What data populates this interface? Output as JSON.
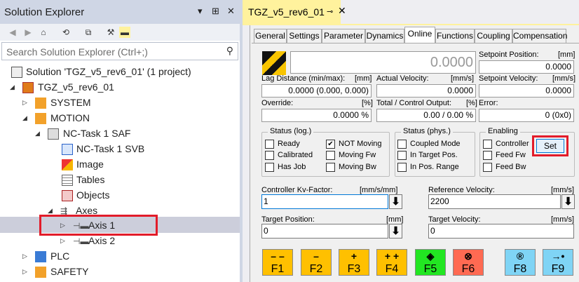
{
  "solution_explorer": {
    "title": "Solution Explorer",
    "title_controls": [
      "▾",
      "⊞",
      "✕"
    ],
    "search_placeholder": "Search Solution Explorer (Ctrl+;)",
    "tree": [
      {
        "label": "Solution 'TGZ_v5_rev6_01' (1 project)",
        "icon": "solution-icon"
      },
      {
        "label": "TGZ_v5_rev6_01",
        "icon": "project-icon"
      },
      {
        "label": "SYSTEM",
        "icon": "system-icon"
      },
      {
        "label": "MOTION",
        "icon": "motion-icon"
      },
      {
        "label": "NC-Task 1 SAF",
        "icon": "nc-task-icon"
      },
      {
        "label": "NC-Task 1 SVB",
        "icon": "nc-svb-icon"
      },
      {
        "label": "Image",
        "icon": "image-icon"
      },
      {
        "label": "Tables",
        "icon": "tables-icon"
      },
      {
        "label": "Objects",
        "icon": "objects-icon"
      },
      {
        "label": "Axes",
        "icon": "axes-icon"
      },
      {
        "label": "Axis 1",
        "icon": "axis-icon"
      },
      {
        "label": "Axis 2",
        "icon": "axis-icon"
      },
      {
        "label": "PLC",
        "icon": "plc-icon"
      },
      {
        "label": "SAFETY",
        "icon": "safety-icon"
      }
    ]
  },
  "document": {
    "tab_title": "TGZ_v5_rev6_01",
    "pin": "⊸",
    "close": "✕",
    "tabs": [
      "General",
      "Settings",
      "Parameter",
      "Dynamics",
      "Online",
      "Functions",
      "Coupling",
      "Compensation"
    ],
    "active_tab": "Online",
    "online": {
      "main_value": "0.0000",
      "setpoint_position": {
        "label": "Setpoint Position:",
        "unit": "[mm]",
        "value": "0.0000"
      },
      "lag_distance": {
        "label": "Lag Distance (min/max):",
        "unit": "[mm]",
        "value": "0.0000  (0.000, 0.000)"
      },
      "actual_velocity": {
        "label": "Actual Velocity:",
        "unit": "[mm/s]",
        "value": "0.0000"
      },
      "setpoint_velocity": {
        "label": "Setpoint Velocity:",
        "unit": "[mm/s]",
        "value": "0.0000"
      },
      "override": {
        "label": "Override:",
        "unit": "[%]",
        "value": "0.0000 %"
      },
      "total_control_output": {
        "label": "Total / Control Output:",
        "unit": "[%]",
        "value": "0.00 /  0.00 %"
      },
      "error": {
        "label": "Error:",
        "value": "0 (0x0)"
      },
      "status_log": {
        "title": "Status (log.)",
        "items": [
          {
            "label": "Ready",
            "checked": false
          },
          {
            "label": "NOT Moving",
            "checked": true
          },
          {
            "label": "Calibrated",
            "checked": false
          },
          {
            "label": "Moving Fw",
            "checked": false
          },
          {
            "label": "Has Job",
            "checked": false
          },
          {
            "label": "Moving Bw",
            "checked": false
          }
        ]
      },
      "status_phys": {
        "title": "Status (phys.)",
        "items": [
          {
            "label": "Coupled Mode",
            "checked": false
          },
          {
            "label": "In Target Pos.",
            "checked": false
          },
          {
            "label": "In Pos. Range",
            "checked": false
          }
        ]
      },
      "enabling": {
        "title": "Enabling",
        "items": [
          {
            "label": "Controller",
            "checked": false
          },
          {
            "label": "Feed Fw",
            "checked": false
          },
          {
            "label": "Feed Bw",
            "checked": false
          }
        ],
        "set_label": "Set"
      },
      "kv_factor": {
        "label": "Controller Kv-Factor:",
        "unit": "[mm/s/mm]",
        "value": "1"
      },
      "reference_velocity": {
        "label": "Reference Velocity:",
        "unit": "[mm/s]",
        "value": "2200"
      },
      "target_position": {
        "label": "Target Position:",
        "unit": "[mm]",
        "value": "0"
      },
      "target_velocity": {
        "label": "Target Velocity:",
        "unit": "[mm/s]",
        "value": "0"
      },
      "down_glyph": "⬇",
      "fkeys": [
        {
          "label": "F1",
          "symbol": "– –",
          "color": "#ffc000"
        },
        {
          "label": "F2",
          "symbol": "–",
          "color": "#ffc000"
        },
        {
          "label": "F3",
          "symbol": "+",
          "color": "#ffc000"
        },
        {
          "label": "F4",
          "symbol": "+ +",
          "color": "#ffc000"
        },
        {
          "label": "F5",
          "symbol": "◈",
          "color": "#22e622"
        },
        {
          "label": "F6",
          "symbol": "⊗",
          "color": "#ff6a52"
        },
        {
          "label": "F8",
          "symbol": "®",
          "color": "#7fd4f5"
        },
        {
          "label": "F9",
          "symbol": "→•",
          "color": "#7fd4f5"
        }
      ]
    }
  }
}
